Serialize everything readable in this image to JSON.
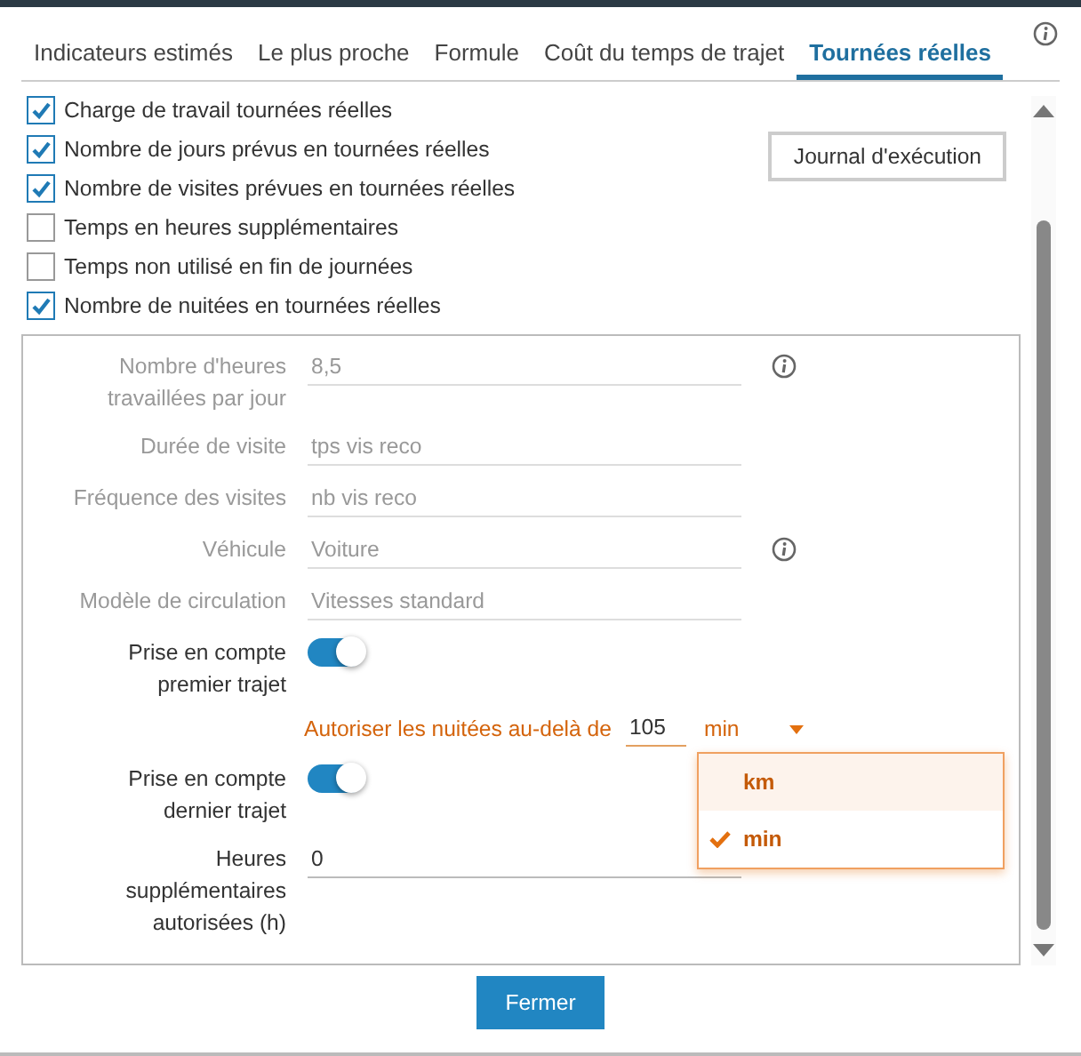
{
  "tabs": [
    {
      "label": "Indicateurs estimés",
      "selected": false
    },
    {
      "label": "Le plus proche",
      "selected": false
    },
    {
      "label": "Formule",
      "selected": false
    },
    {
      "label": "Coût du temps de trajet",
      "selected": false
    },
    {
      "label": "Tournées réelles",
      "selected": true
    }
  ],
  "checkboxes": [
    {
      "label": "Charge de travail tournées réelles",
      "checked": true
    },
    {
      "label": "Nombre de jours prévus en tournées réelles",
      "checked": true
    },
    {
      "label": "Nombre de visites prévues en tournées réelles",
      "checked": true
    },
    {
      "label": "Temps en heures supplémentaires",
      "checked": false
    },
    {
      "label": "Temps non utilisé en fin de journées",
      "checked": false
    },
    {
      "label": "Nombre de nuitées en tournées réelles",
      "checked": true
    }
  ],
  "log_button": "Journal d'exécution",
  "fields": [
    {
      "kind": "text",
      "label": "Nombre d'heures travaillées par jour",
      "value": "8,5",
      "disabled": true,
      "info": true
    },
    {
      "kind": "text",
      "label": "Durée de visite",
      "value": "tps vis reco",
      "disabled": true,
      "info": false
    },
    {
      "kind": "text",
      "label": "Fréquence des visites",
      "value": "nb vis reco",
      "disabled": true,
      "info": false
    },
    {
      "kind": "text",
      "label": "Véhicule",
      "value": "Voiture",
      "disabled": true,
      "info": true
    },
    {
      "kind": "text",
      "label": "Modèle de circulation",
      "value": "Vitesses standard",
      "disabled": true,
      "info": false
    },
    {
      "kind": "toggle",
      "label": "Prise en compte premier trajet",
      "on": true
    },
    {
      "kind": "threshold",
      "label": "Autoriser les nuitées au-delà de",
      "value": "105",
      "unit": "min",
      "expanded": true,
      "options": [
        {
          "label": "km",
          "selected": false,
          "highlighted": true
        },
        {
          "label": "min",
          "selected": true,
          "highlighted": false
        }
      ]
    },
    {
      "kind": "toggle",
      "label": "Prise en compte dernier trajet",
      "on": true
    },
    {
      "kind": "text",
      "label": "Heures supplémentaires autorisées (h)",
      "value": "0",
      "disabled": false,
      "info": false
    }
  ],
  "close_button": "Fermer"
}
